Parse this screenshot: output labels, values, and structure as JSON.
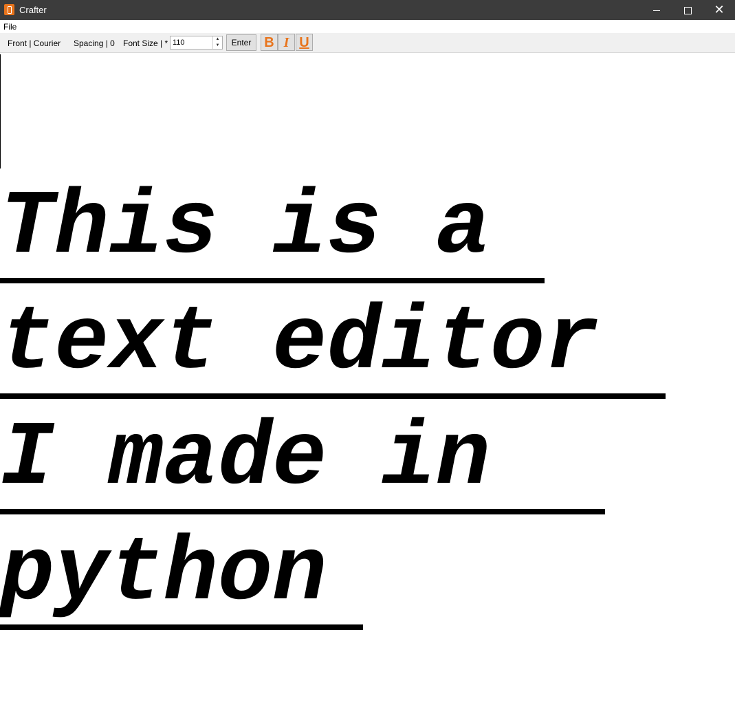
{
  "window": {
    "title": "Crafter",
    "minimize": "—",
    "maximize": "☐",
    "close": "✕"
  },
  "menu": {
    "file": "File"
  },
  "toolbar": {
    "font_label": "Front | Courier",
    "spacing_label": "Spacing | 0",
    "font_size_label": "Font Size | *",
    "font_size_value": "110",
    "enter_label": "Enter",
    "bold_label": "B",
    "italic_label": "I",
    "underline_label": "U",
    "accent_color": "#e8741c"
  },
  "editor": {
    "lines": [
      "This is a",
      "text editor",
      "I made in",
      "python"
    ],
    "bold": true,
    "italic": true,
    "underline": true
  }
}
